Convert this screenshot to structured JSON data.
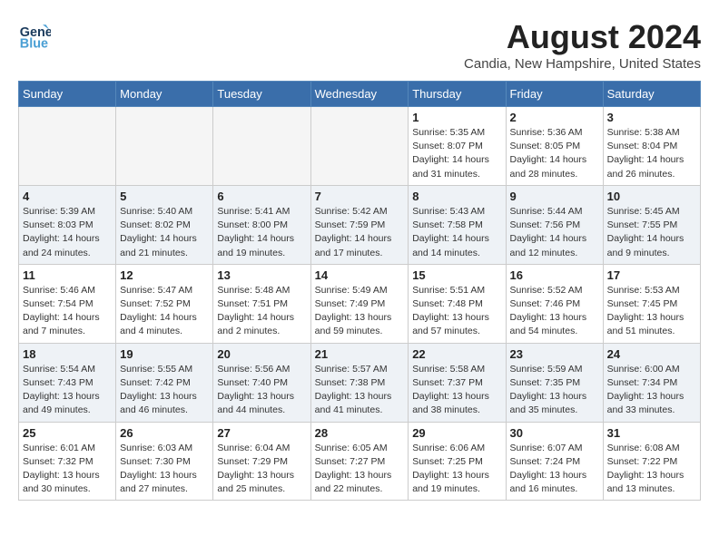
{
  "header": {
    "logo_line1": "General",
    "logo_line2": "Blue",
    "month_year": "August 2024",
    "location": "Candia, New Hampshire, United States"
  },
  "weekdays": [
    "Sunday",
    "Monday",
    "Tuesday",
    "Wednesday",
    "Thursday",
    "Friday",
    "Saturday"
  ],
  "weeks": [
    [
      {
        "day": "",
        "info": ""
      },
      {
        "day": "",
        "info": ""
      },
      {
        "day": "",
        "info": ""
      },
      {
        "day": "",
        "info": ""
      },
      {
        "day": "1",
        "info": "Sunrise: 5:35 AM\nSunset: 8:07 PM\nDaylight: 14 hours\nand 31 minutes."
      },
      {
        "day": "2",
        "info": "Sunrise: 5:36 AM\nSunset: 8:05 PM\nDaylight: 14 hours\nand 28 minutes."
      },
      {
        "day": "3",
        "info": "Sunrise: 5:38 AM\nSunset: 8:04 PM\nDaylight: 14 hours\nand 26 minutes."
      }
    ],
    [
      {
        "day": "4",
        "info": "Sunrise: 5:39 AM\nSunset: 8:03 PM\nDaylight: 14 hours\nand 24 minutes."
      },
      {
        "day": "5",
        "info": "Sunrise: 5:40 AM\nSunset: 8:02 PM\nDaylight: 14 hours\nand 21 minutes."
      },
      {
        "day": "6",
        "info": "Sunrise: 5:41 AM\nSunset: 8:00 PM\nDaylight: 14 hours\nand 19 minutes."
      },
      {
        "day": "7",
        "info": "Sunrise: 5:42 AM\nSunset: 7:59 PM\nDaylight: 14 hours\nand 17 minutes."
      },
      {
        "day": "8",
        "info": "Sunrise: 5:43 AM\nSunset: 7:58 PM\nDaylight: 14 hours\nand 14 minutes."
      },
      {
        "day": "9",
        "info": "Sunrise: 5:44 AM\nSunset: 7:56 PM\nDaylight: 14 hours\nand 12 minutes."
      },
      {
        "day": "10",
        "info": "Sunrise: 5:45 AM\nSunset: 7:55 PM\nDaylight: 14 hours\nand 9 minutes."
      }
    ],
    [
      {
        "day": "11",
        "info": "Sunrise: 5:46 AM\nSunset: 7:54 PM\nDaylight: 14 hours\nand 7 minutes."
      },
      {
        "day": "12",
        "info": "Sunrise: 5:47 AM\nSunset: 7:52 PM\nDaylight: 14 hours\nand 4 minutes."
      },
      {
        "day": "13",
        "info": "Sunrise: 5:48 AM\nSunset: 7:51 PM\nDaylight: 14 hours\nand 2 minutes."
      },
      {
        "day": "14",
        "info": "Sunrise: 5:49 AM\nSunset: 7:49 PM\nDaylight: 13 hours\nand 59 minutes."
      },
      {
        "day": "15",
        "info": "Sunrise: 5:51 AM\nSunset: 7:48 PM\nDaylight: 13 hours\nand 57 minutes."
      },
      {
        "day": "16",
        "info": "Sunrise: 5:52 AM\nSunset: 7:46 PM\nDaylight: 13 hours\nand 54 minutes."
      },
      {
        "day": "17",
        "info": "Sunrise: 5:53 AM\nSunset: 7:45 PM\nDaylight: 13 hours\nand 51 minutes."
      }
    ],
    [
      {
        "day": "18",
        "info": "Sunrise: 5:54 AM\nSunset: 7:43 PM\nDaylight: 13 hours\nand 49 minutes."
      },
      {
        "day": "19",
        "info": "Sunrise: 5:55 AM\nSunset: 7:42 PM\nDaylight: 13 hours\nand 46 minutes."
      },
      {
        "day": "20",
        "info": "Sunrise: 5:56 AM\nSunset: 7:40 PM\nDaylight: 13 hours\nand 44 minutes."
      },
      {
        "day": "21",
        "info": "Sunrise: 5:57 AM\nSunset: 7:38 PM\nDaylight: 13 hours\nand 41 minutes."
      },
      {
        "day": "22",
        "info": "Sunrise: 5:58 AM\nSunset: 7:37 PM\nDaylight: 13 hours\nand 38 minutes."
      },
      {
        "day": "23",
        "info": "Sunrise: 5:59 AM\nSunset: 7:35 PM\nDaylight: 13 hours\nand 35 minutes."
      },
      {
        "day": "24",
        "info": "Sunrise: 6:00 AM\nSunset: 7:34 PM\nDaylight: 13 hours\nand 33 minutes."
      }
    ],
    [
      {
        "day": "25",
        "info": "Sunrise: 6:01 AM\nSunset: 7:32 PM\nDaylight: 13 hours\nand 30 minutes."
      },
      {
        "day": "26",
        "info": "Sunrise: 6:03 AM\nSunset: 7:30 PM\nDaylight: 13 hours\nand 27 minutes."
      },
      {
        "day": "27",
        "info": "Sunrise: 6:04 AM\nSunset: 7:29 PM\nDaylight: 13 hours\nand 25 minutes."
      },
      {
        "day": "28",
        "info": "Sunrise: 6:05 AM\nSunset: 7:27 PM\nDaylight: 13 hours\nand 22 minutes."
      },
      {
        "day": "29",
        "info": "Sunrise: 6:06 AM\nSunset: 7:25 PM\nDaylight: 13 hours\nand 19 minutes."
      },
      {
        "day": "30",
        "info": "Sunrise: 6:07 AM\nSunset: 7:24 PM\nDaylight: 13 hours\nand 16 minutes."
      },
      {
        "day": "31",
        "info": "Sunrise: 6:08 AM\nSunset: 7:22 PM\nDaylight: 13 hours\nand 13 minutes."
      }
    ]
  ]
}
